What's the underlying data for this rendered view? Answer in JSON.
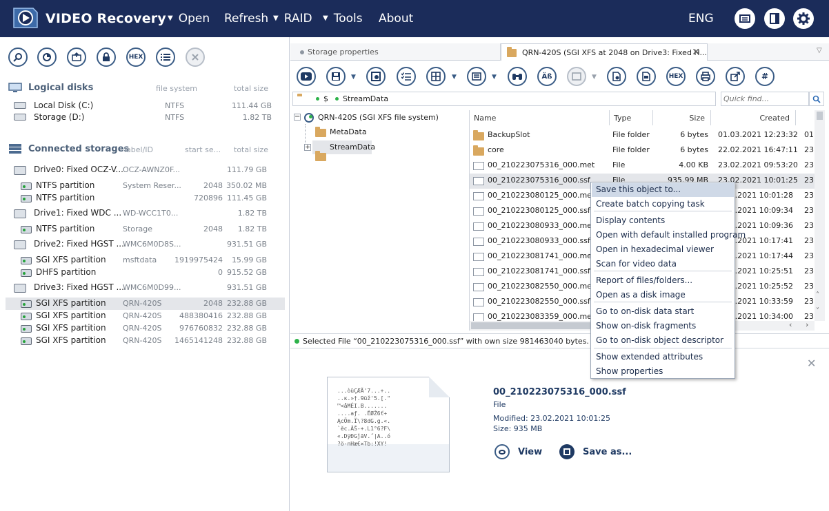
{
  "app": {
    "title": "VIDEO Recovery",
    "lang": "ENG"
  },
  "menu": {
    "open": "Open",
    "refresh": "Refresh",
    "raid": "RAID",
    "tools": "Tools",
    "about": "About"
  },
  "left_toolbar": {
    "hex": "HEX"
  },
  "logical": {
    "title": "Logical disks",
    "col_fs": "file system",
    "col_size": "total size",
    "items": [
      {
        "name": "Local Disk (C:)",
        "fs": "NTFS",
        "size": "111.44 GB"
      },
      {
        "name": "Storage (D:)",
        "fs": "NTFS",
        "size": "1.82 TB"
      }
    ]
  },
  "storages": {
    "title": "Connected storages",
    "col_label": "label/ID",
    "col_start": "start se...",
    "col_size": "total size",
    "rows": [
      {
        "kind": "drive",
        "name": "Drive0: Fixed OCZ-V...",
        "label": "OCZ-AWNZ0F...",
        "start": "",
        "size": "111.79 GB"
      },
      {
        "kind": "part",
        "name": "NTFS partition",
        "label": "System Reser...",
        "start": "2048",
        "size": "350.02 MB"
      },
      {
        "kind": "part",
        "name": "NTFS partition",
        "label": "",
        "start": "720896",
        "size": "111.45 GB"
      },
      {
        "kind": "drive",
        "name": "Drive1: Fixed WDC ...",
        "label": "WD-WCC1T0...",
        "start": "",
        "size": "1.82 TB"
      },
      {
        "kind": "part",
        "name": "NTFS partition",
        "label": "Storage",
        "start": "2048",
        "size": "1.82 TB"
      },
      {
        "kind": "drive",
        "name": "Drive2: Fixed HGST ...",
        "label": "WMC6M0D8S...",
        "start": "",
        "size": "931.51 GB"
      },
      {
        "kind": "part",
        "name": "SGI XFS partition",
        "label": "msftdata",
        "start": "1919975424",
        "size": "15.99 GB"
      },
      {
        "kind": "part",
        "name": "DHFS partition",
        "label": "",
        "start": "0",
        "size": "915.52 GB"
      },
      {
        "kind": "drive",
        "name": "Drive3: Fixed HGST ...",
        "label": "WMC6M0D99...",
        "start": "",
        "size": "931.51 GB"
      },
      {
        "kind": "part",
        "name": "SGI XFS partition",
        "label": "QRN-420S",
        "start": "2048",
        "size": "232.88 GB"
      },
      {
        "kind": "part",
        "name": "SGI XFS partition",
        "label": "QRN-420S",
        "start": "488380416",
        "size": "232.88 GB"
      },
      {
        "kind": "part",
        "name": "SGI XFS partition",
        "label": "QRN-420S",
        "start": "976760832",
        "size": "232.88 GB"
      },
      {
        "kind": "part",
        "name": "SGI XFS partition",
        "label": "QRN-420S",
        "start": "1465141248",
        "size": "232.88 GB"
      }
    ]
  },
  "tabs": {
    "storage": "Storage properties",
    "qrn": "QRN-420S (SGI XFS at 2048 on Drive3: Fixed H..."
  },
  "right_toolbar": {
    "hex": "HEX"
  },
  "path": {
    "root": "$",
    "folder": "StreamData",
    "search_placeholder": "Quick find..."
  },
  "tree": {
    "root": "QRN-420S (SGI XFS file system)",
    "items": [
      "MetaData",
      "StreamData"
    ]
  },
  "columns": {
    "name": "Name",
    "type": "Type",
    "size": "Size",
    "created": "Created"
  },
  "files": [
    {
      "name": "BackupSlot",
      "type": "File folder",
      "size": "6 bytes",
      "created": "01.03.2021 12:23:32",
      "extra": "01",
      "folder": true
    },
    {
      "name": "core",
      "type": "File folder",
      "size": "6 bytes",
      "created": "22.02.2021 16:47:11",
      "extra": "23",
      "folder": true
    },
    {
      "name": "00_210223075316_000.met",
      "type": "File",
      "size": "4.00 KB",
      "created": "23.02.2021 09:53:20",
      "extra": "23"
    },
    {
      "name": "00_210223075316_000.ssf",
      "type": "File",
      "size": "935.99 MB",
      "created": "23.02.2021 10:01:25",
      "extra": "23"
    },
    {
      "name": "00_210223080125_000.met",
      "type": "",
      "size": "",
      "created": ".02.2021 10:01:28",
      "extra": "23"
    },
    {
      "name": "00_210223080125_000.ssf",
      "type": "",
      "size": "",
      "created": ".02.2021 10:09:34",
      "extra": "23"
    },
    {
      "name": "00_210223080933_000.met",
      "type": "",
      "size": "",
      "created": ".02.2021 10:09:36",
      "extra": "23"
    },
    {
      "name": "00_210223080933_000.ssf",
      "type": "",
      "size": "",
      "created": ".02.2021 10:17:41",
      "extra": "23"
    },
    {
      "name": "00_210223081741_000.met",
      "type": "",
      "size": "",
      "created": ".02.2021 10:17:44",
      "extra": "23"
    },
    {
      "name": "00_210223081741_000.ssf",
      "type": "",
      "size": "",
      "created": ".02.2021 10:25:51",
      "extra": "23"
    },
    {
      "name": "00_210223082550_000.met",
      "type": "",
      "size": "",
      "created": ".02.2021 10:25:52",
      "extra": "23"
    },
    {
      "name": "00_210223082550_000.ssf",
      "type": "",
      "size": "",
      "created": ".02.2021 10:33:59",
      "extra": "23"
    },
    {
      "name": "00_210223083359_000.met",
      "type": "",
      "size": "",
      "created": ".02.2021 10:34:00",
      "extra": "23"
    }
  ],
  "context_menu": [
    "Save this object to...",
    "Create batch copying task",
    "Display contents",
    "Open with default installed program",
    "Open in hexadecimal viewer",
    "Scan for video data",
    "Report of files/folders...",
    "Open as a disk image",
    "Go to on-disk data start",
    "Show on-disk fragments",
    "Go to on-disk object descriptor",
    "Show extended attributes",
    "Show properties"
  ],
  "status": {
    "text": "Selected File “00_210223075316_000.ssf” with own size 981463040 bytes."
  },
  "preview": {
    "name": "00_210223075316_000.ssf",
    "type": "File",
    "modified": "Modified: 23.02.2021 10:01:25",
    "size": "Size: 935 MB",
    "view": "View",
    "save": "Save as...",
    "hex_lines": [
      "...òüÇÆÄ'7...+..",
      "..ĸ.»†.9üž'5.[.\"",
      "™<åMÉI.B.......",
      "....aƒ. .ËØŽ6ť+",
      "ĄcÖm.Ï\\?8dG.g.«.",
      "`ĕc.ÂŠ-+.L1°6?F\\",
      "«.DÿÐGĵāV.˝|A..ó",
      "?ö-nHæ€×Tb:!XY!"
    ]
  },
  "colors": {
    "topbar": "#1b2c5a",
    "accent": "#3a5c86",
    "status_ok": "#2db24a"
  }
}
